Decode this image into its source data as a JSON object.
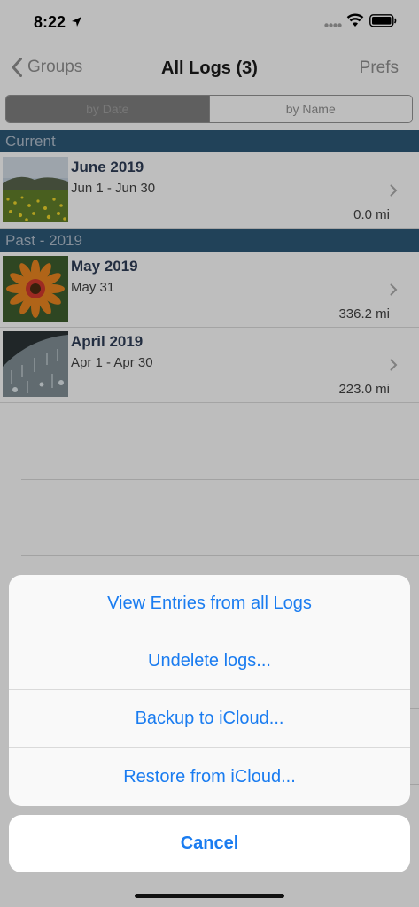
{
  "status": {
    "time": "8:22"
  },
  "nav": {
    "back_label": "Groups",
    "title": "All Logs (3)",
    "right_label": "Prefs"
  },
  "segment": {
    "options": [
      "by Date",
      "by Name"
    ],
    "selected": "by Date"
  },
  "sections": [
    {
      "title": "Current",
      "rows": [
        {
          "title": "June 2019",
          "dates": "Jun 1 - Jun 30",
          "distance": "0.0 mi"
        }
      ]
    },
    {
      "title": "Past - 2019",
      "rows": [
        {
          "title": "May 2019",
          "dates": "May 31",
          "distance": "336.2 mi"
        },
        {
          "title": "April 2019",
          "dates": "Apr 1 - Apr 30",
          "distance": "223.0 mi"
        }
      ]
    }
  ],
  "action_sheet": {
    "items": [
      "View Entries from all Logs",
      "Undelete logs...",
      "Backup to iCloud...",
      "Restore from iCloud..."
    ],
    "cancel": "Cancel"
  },
  "colors": {
    "accent": "#1a7cf0",
    "section_header": "#2b5572"
  }
}
